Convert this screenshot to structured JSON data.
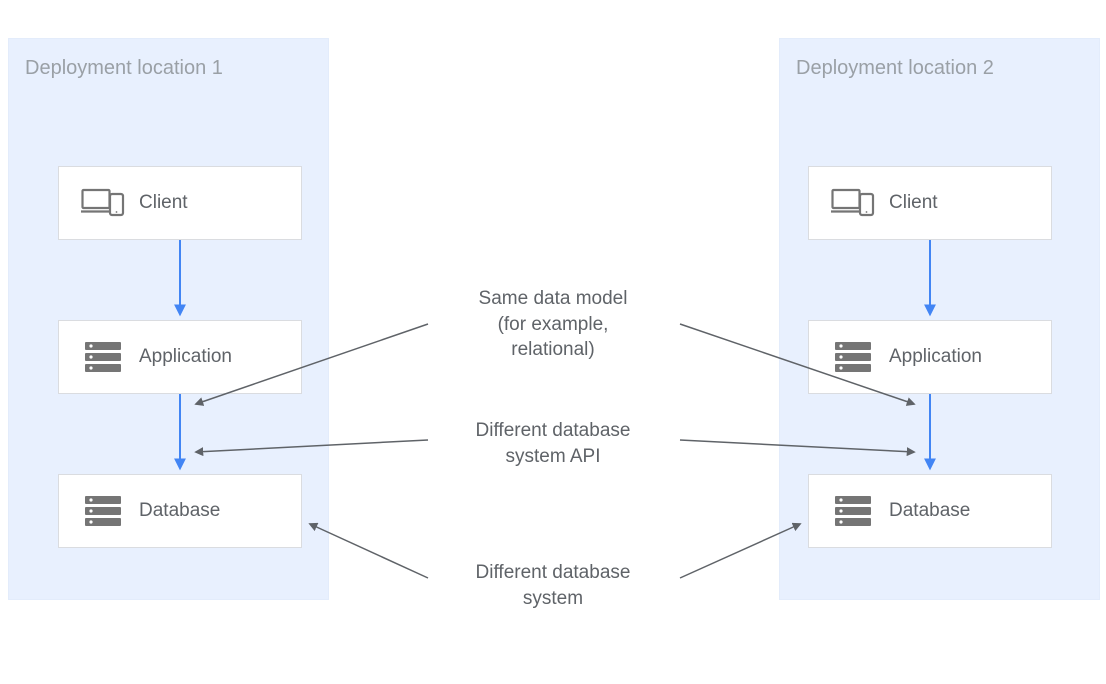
{
  "regions": {
    "left": {
      "title": "Deployment location 1"
    },
    "right": {
      "title": "Deployment location 2"
    }
  },
  "nodes": {
    "client": "Client",
    "application": "Application",
    "database": "Database"
  },
  "annotations": {
    "same_model_l1": "Same data model",
    "same_model_l2": "(for example,",
    "same_model_l3": "relational)",
    "diff_api_l1": "Different database",
    "diff_api_l2": "system API",
    "diff_system_l1": "Different database",
    "diff_system_l2": "system"
  }
}
